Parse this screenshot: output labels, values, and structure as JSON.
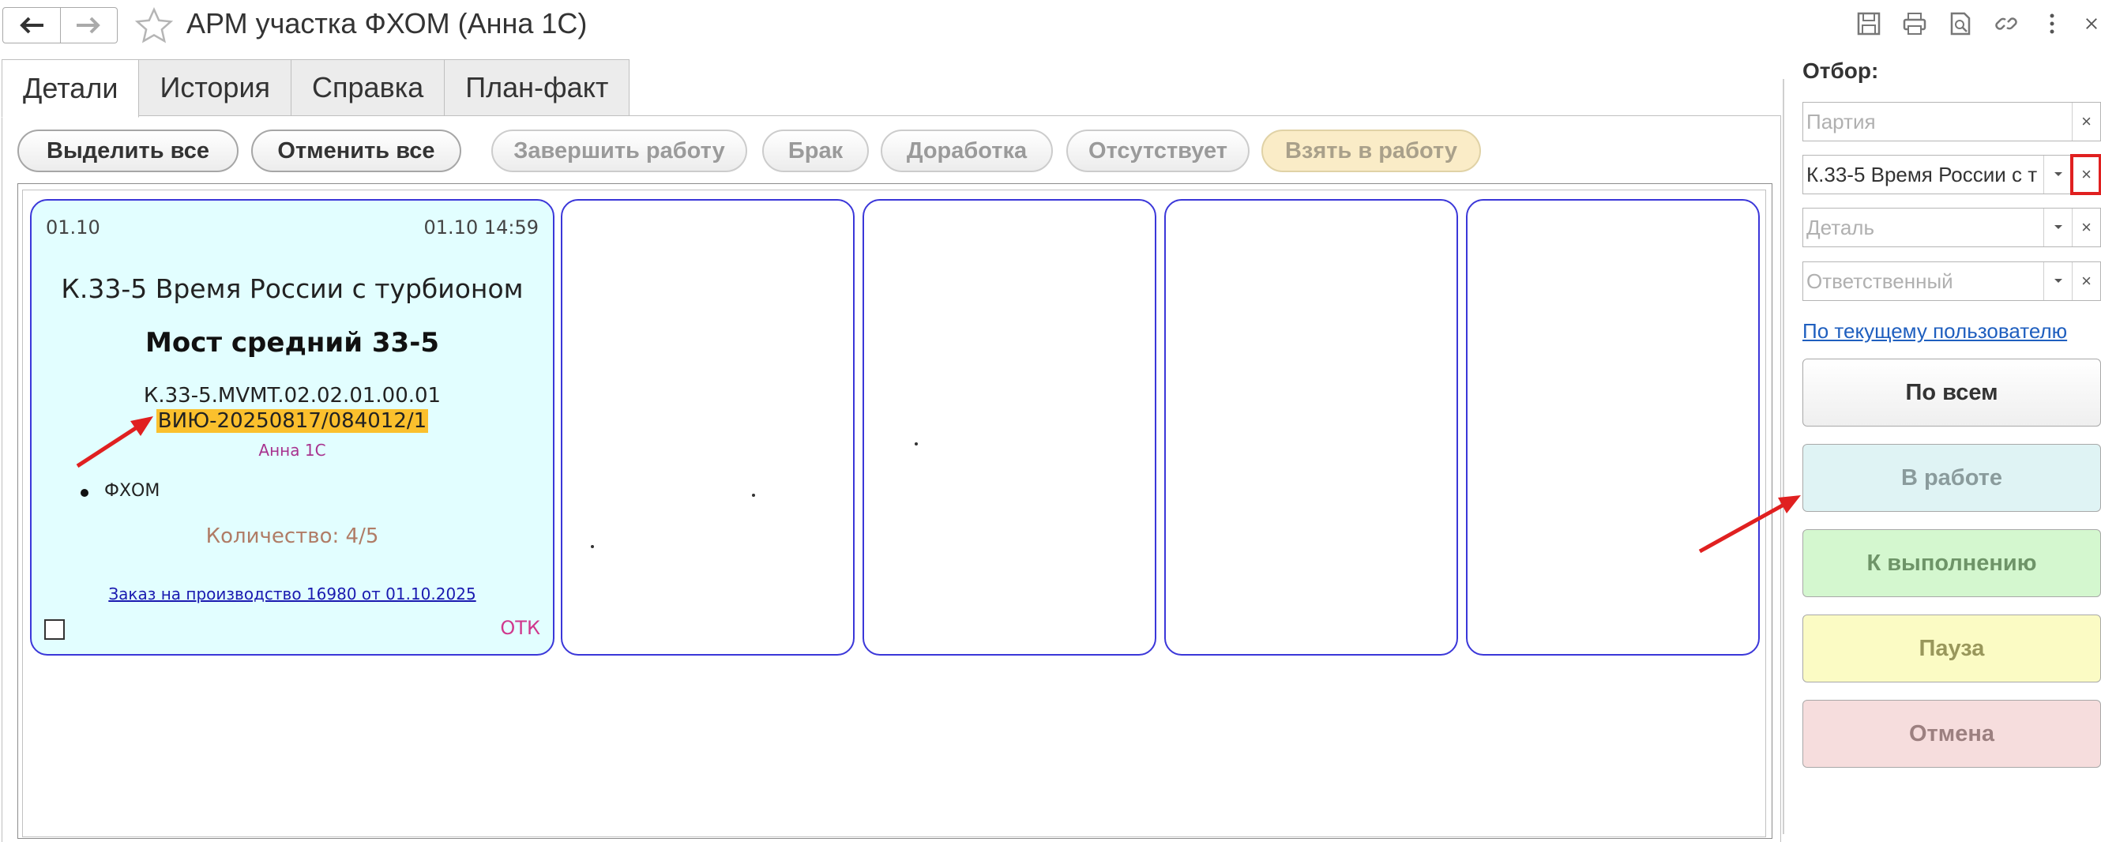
{
  "window": {
    "title": "АРМ участка ФХОМ (Анна 1С)",
    "icons": [
      "arrow-left-icon",
      "arrow-right-icon",
      "star-icon",
      "save-icon",
      "print-icon",
      "preview-icon",
      "link-icon",
      "more-icon",
      "close-icon"
    ]
  },
  "tabs": [
    {
      "label": "Детали",
      "active": true
    },
    {
      "label": "История",
      "active": false
    },
    {
      "label": "Справка",
      "active": false
    },
    {
      "label": "План-факт",
      "active": false
    }
  ],
  "toolbar": {
    "select_all": "Выделить все",
    "cancel_all": "Отменить все",
    "finish": "Завершить работу",
    "defect": "Брак",
    "rework": "Доработка",
    "absent": "Отсутствует",
    "take": "Взять в работу"
  },
  "card": {
    "date_left": "01.10",
    "date_right": "01.10 14:59",
    "title": "К.33-5 Время России с турбионом",
    "subtitle": "Мост средний 33-5",
    "code": "К.33-5.MVMT.02.02.01.00.01",
    "lot": "ВИЮ-20250817/084012/1",
    "user": "Анна 1С",
    "bullet": "ФХОМ",
    "quantity": "Количество: 4/5",
    "order_link": "Заказ на производство 16980 от 01.10.2025",
    "otk": "ОТК"
  },
  "filter": {
    "label": "Отбор:",
    "party_placeholder": "Партия",
    "product_value": "К.33-5 Время России с т",
    "detail_placeholder": "Деталь",
    "responsible_placeholder": "Ответственный",
    "current_user_link": "По текущему пользователю",
    "clear_symbol": "×"
  },
  "status_buttons": {
    "all": "По всем",
    "in_work": "В работе",
    "to_do": "К выполнению",
    "pause": "Пауза",
    "cancel": "Отмена"
  },
  "colors": {
    "card_border": "#3b37d9",
    "card_bg": "#e2feff",
    "lot_highlight": "#fbc02d",
    "annotation_red": "#e02020",
    "in_work_bg": "#dff3f4",
    "to_do_bg": "#d4f7cf",
    "pause_bg": "#fbfbc4",
    "cancel_bg": "#f6dddd"
  }
}
